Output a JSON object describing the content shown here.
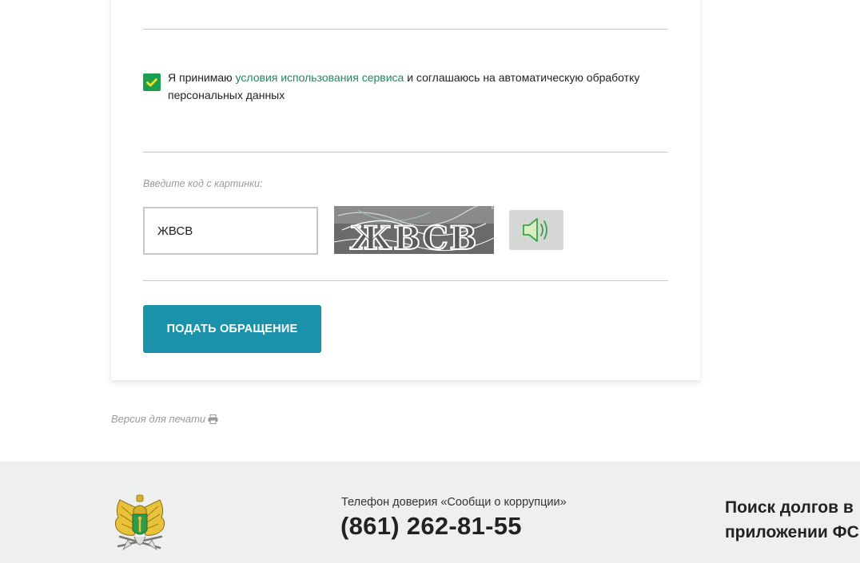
{
  "form": {
    "consent": {
      "checked": true,
      "text_before": "Я принимаю ",
      "link_text": "условия использования сервиса",
      "text_after": " и соглашаюсь на автоматическую обработку персональных данных"
    },
    "captcha": {
      "label": "Введите код с картинки:",
      "input_value": "ЖВСВ",
      "image_text": "ЖBCB"
    },
    "submit_label": "ПОДАТЬ ОБРАЩЕНИЕ"
  },
  "print_version_label": "Версия для печати",
  "footer": {
    "hotline_label": "Телефон доверия «Сообщи о коррупции»",
    "hotline_phone": "(861) 262-81-55",
    "app_promo_line1": "Поиск долгов в",
    "app_promo_line2": "приложении ФС"
  },
  "colors": {
    "checkbox": "#1c9e52",
    "link": "#1f8a5a",
    "submit_button": "#1a93aa",
    "footer_bg": "#eef0ef"
  }
}
